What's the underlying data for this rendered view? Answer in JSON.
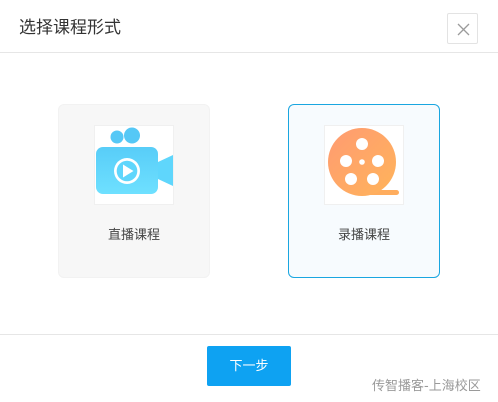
{
  "dialog": {
    "title": "选择课程形式",
    "close_icon": "close-icon"
  },
  "options": [
    {
      "label": "直播课程",
      "icon": "live-video-camera-icon",
      "selected": false
    },
    {
      "label": "录播课程",
      "icon": "film-reel-icon",
      "selected": true
    }
  ],
  "footer": {
    "next_label": "下一步",
    "watermark": "传智播客-上海校区"
  },
  "colors": {
    "accent": "#0ea2f2",
    "selected_border": "#1aa6e0",
    "camera": "#5fd3fb",
    "reel_start": "#ff9d6c",
    "reel_end": "#ffb25e"
  }
}
